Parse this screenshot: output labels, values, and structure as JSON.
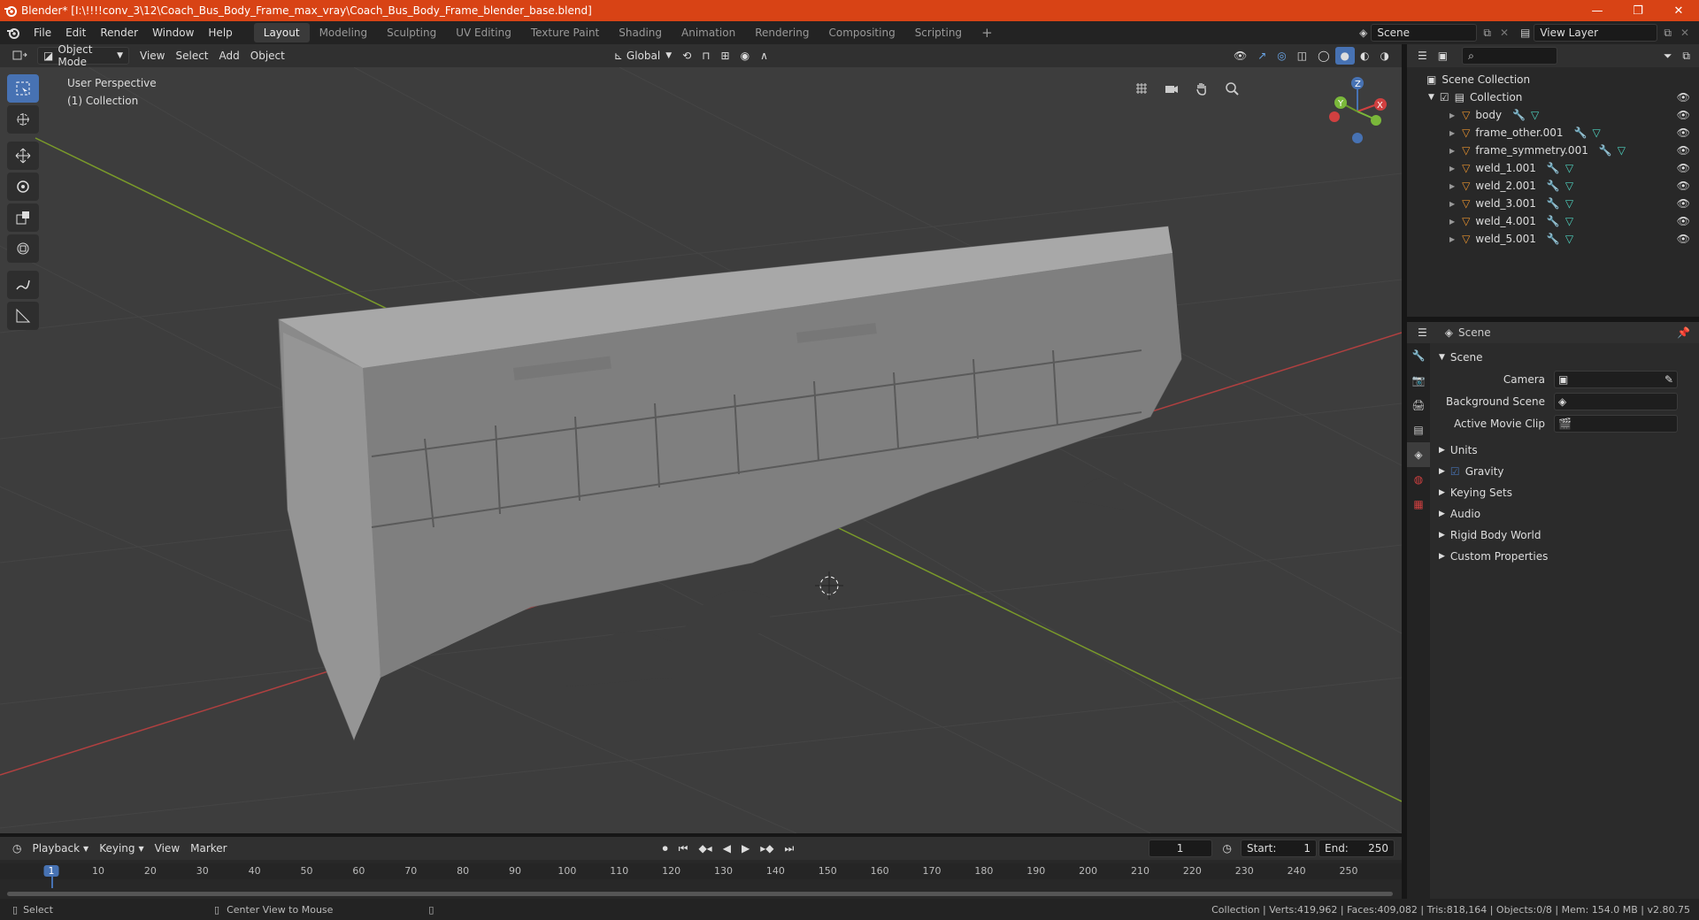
{
  "titlebar": {
    "title": "Blender* [I:\\!!!!conv_3\\12\\Coach_Bus_Body_Frame_max_vray\\Coach_Bus_Body_Frame_blender_base.blend]",
    "minimize": "—",
    "maximize": "❐",
    "close": "✕"
  },
  "topbar": {
    "menus": [
      "File",
      "Edit",
      "Render",
      "Window",
      "Help"
    ],
    "workspaces": [
      "Layout",
      "Modeling",
      "Sculpting",
      "UV Editing",
      "Texture Paint",
      "Shading",
      "Animation",
      "Rendering",
      "Compositing",
      "Scripting"
    ],
    "active_workspace": "Layout",
    "add_tab": "+",
    "scene": "Scene",
    "view_layer": "View Layer"
  },
  "viewport_header": {
    "mode": "Object Mode",
    "menus": [
      "View",
      "Select",
      "Add",
      "Object"
    ],
    "orientation": "Global"
  },
  "viewport": {
    "perspective": "User Perspective",
    "collection": "(1) Collection"
  },
  "outliner": {
    "search_placeholder": "",
    "root": "Scene Collection",
    "collection": "Collection",
    "items": [
      "body",
      "frame_other.001",
      "frame_symmetry.001",
      "weld_1.001",
      "weld_2.001",
      "weld_3.001",
      "weld_4.001",
      "weld_5.001"
    ]
  },
  "properties": {
    "header_title": "Scene",
    "section": "Scene",
    "rows": [
      {
        "label": "Camera",
        "value": ""
      },
      {
        "label": "Background Scene",
        "value": ""
      },
      {
        "label": "Active Movie Clip",
        "value": ""
      }
    ],
    "subsections": [
      "Units",
      "Gravity",
      "Keying Sets",
      "Audio",
      "Rigid Body World",
      "Custom Properties"
    ]
  },
  "timeline": {
    "menus": [
      "Playback",
      "Keying",
      "View",
      "Marker"
    ],
    "current_frame": "1",
    "start_label": "Start:",
    "start": "1",
    "end_label": "End:",
    "end": "250",
    "ticks": [
      "1",
      "10",
      "20",
      "30",
      "40",
      "50",
      "60",
      "70",
      "80",
      "90",
      "100",
      "110",
      "120",
      "130",
      "140",
      "150",
      "160",
      "170",
      "180",
      "190",
      "200",
      "210",
      "220",
      "230",
      "240",
      "250"
    ]
  },
  "statusbar": {
    "left_action": "Select",
    "middle_action": "Center View to Mouse",
    "stats": "Collection | Verts:419,962 | Faces:409,082 | Tris:818,164 | Objects:0/8 | Mem: 154.0 MB | v2.80.75"
  },
  "colors": {
    "titlebar": "#d84315",
    "accent": "#4772b3",
    "object_orange": "#e8922e",
    "mesh_teal": "#4fd3c0",
    "modifier_blue": "#6aa6e8"
  }
}
